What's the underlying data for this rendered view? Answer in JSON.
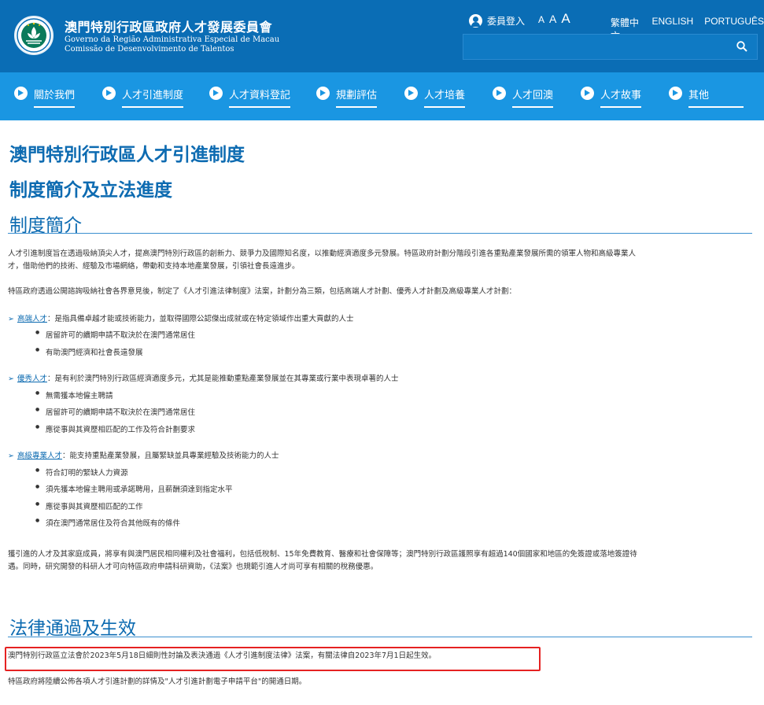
{
  "header": {
    "org_title": "澳門特別行政區政府人才發展委員會",
    "org_sub_pt_1": "Governo da Região Administrativa Especial de Macau",
    "org_sub_pt_2": "Comissão de Desenvolvimento de Talentos",
    "login_label": "委員登入",
    "font_small": "A",
    "font_medium": "A",
    "font_large": "A",
    "languages": [
      "繁體中文",
      "ENGLISH",
      "PORTUGUÊS"
    ],
    "search_placeholder": ""
  },
  "nav": {
    "items": [
      "關於我們",
      "人才引進制度",
      "人才資料登記",
      "規劃評估",
      "人才培養",
      "人才回澳",
      "人才故事",
      "其他"
    ]
  },
  "main": {
    "title_1": "澳門特別行政區人才引進制度",
    "title_2": "制度簡介及立法進度",
    "section_1": "制度簡介",
    "intro_p1_line1": "人才引進制度旨在透過吸納頂尖人才，提高澳門特別行政區的創新力、競爭力及國際知名度，以推動經濟適度多元發展。特區政府計劃分階段引進各重點產業發展所需的領軍人物和高級專業人",
    "intro_p1_line2": "才，借助他們的技術、經驗及市場網絡，帶動和支持本地產業發展，引領社會長遠進步。",
    "intro_p2": "特區政府透過公開諮詢吸納社會各界意見後，制定了《人才引進法律制度》法案，計劃分為三類，包括高端人才計劃、優秀人才計劃及高級專業人才計劃：",
    "categories": [
      {
        "name": "高端人才",
        "desc": "：是指具備卓越才能或技術能力，並取得國際公認傑出成就或在特定領域作出重大貢獻的人士",
        "bullets": [
          "居留許可的續期申請不取決於在澳門通常居住",
          "有助澳門經濟和社會長遠發展"
        ]
      },
      {
        "name": "優秀人才",
        "desc": "：是有利於澳門特別行政區經濟適度多元，尤其是能推動重點產業發展並在其專業或行業中表現卓著的人士",
        "bullets": [
          "無需獲本地僱主聘請",
          "居留許可的續期申請不取決於在澳門通常居住",
          "應從事與其資歷相匹配的工作及符合計劃要求"
        ]
      },
      {
        "name": "高級專業人才",
        "desc": "：能支持重點產業發展，且屬緊缺並具專業經驗及技術能力的人士",
        "bullets": [
          "符合訂明的緊缺人力資源",
          "須先獲本地僱主聘用或承諾聘用，且薪酬須達到指定水平",
          "應從事與其資歷相匹配的工作",
          "須在澳門通常居住及符合其他既有的條件"
        ]
      }
    ],
    "benefits_line1": "獲引進的人才及其家庭成員，將享有與澳門居民相同權利及社會福利，包括低稅制、15年免費教育、醫療和社會保障等；澳門特別行政區護照享有超過140個國家和地區的免簽證或落地簽證待",
    "benefits_line2": "遇。同時，研究開發的科研人才可向特區政府申請科研資助，《法案》也規範引進人才尚可享有相關的稅務優惠。",
    "section_2": "法律通過及生效",
    "law_text": "澳門特別行政區立法會於2023年5月18日細則性討論及表決通過《人才引進制度法律》法案，有關法律自2023年7月1日起生效。",
    "last_line": "特區政府將陸續公佈各項人才引進計劃的詳情及\"人才引進計劃電子申請平台\"的開通日期。"
  },
  "colors": {
    "header_bg": "#0a6db5",
    "nav_bg": "#1a96e2",
    "heading": "#0d6bb1",
    "highlight_border": "#e52222"
  }
}
